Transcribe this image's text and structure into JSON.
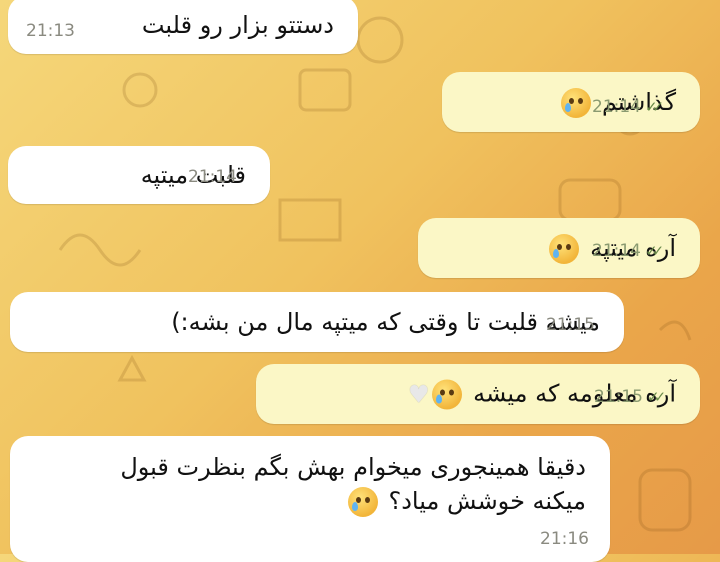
{
  "messages": [
    {
      "text": "دستتو بزار رو قلبت",
      "time": "21:13",
      "dir": "in"
    },
    {
      "text": "گذاشتم",
      "time": "21:14",
      "dir": "out",
      "emoji": "smiling-face-with-tear-emoji"
    },
    {
      "text": "قلبت میتپه",
      "time": "21:14",
      "dir": "in"
    },
    {
      "text": "آره میتپه",
      "time": "21:14",
      "dir": "out",
      "emoji": "crying-face-emoji"
    },
    {
      "text": "میشه قلبت تا وقتی که میتپه مال من بشه:)",
      "time": "21:15",
      "dir": "in"
    },
    {
      "text": "آره معلومه که میشه",
      "time": "21:15",
      "dir": "out",
      "emoji": "crying-face-emoji",
      "emoji2": "white-heart-emoji"
    },
    {
      "line1": "دقیقا همینجوری میخوام بهش بگم بنظرت قبول",
      "line2": "میکنه خوشش میاد؟",
      "time": "21:16",
      "dir": "in",
      "emoji": "crying-face-emoji"
    }
  ],
  "colors": {
    "incoming": "#ffffff",
    "outgoing": "#fbf7c6",
    "wallpaper": "#f0c25e"
  },
  "read_icon": "double-check-icon",
  "read_glyph": "✓✓"
}
